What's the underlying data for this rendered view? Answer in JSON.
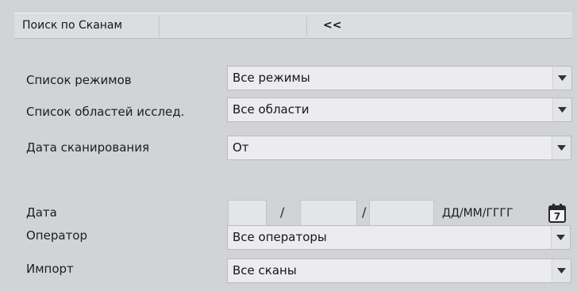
{
  "panel": {
    "title": "Поиск по Сканам",
    "collapse_label": "<<"
  },
  "rows": {
    "modes": {
      "label": "Список режимов",
      "value": "Все режимы"
    },
    "regions": {
      "label": "Список областей исслед.",
      "value": "Все области"
    },
    "scan_date": {
      "label": "Дата сканирования",
      "value": "От"
    },
    "date": {
      "label": "Дата",
      "separator_1": "/",
      "separator_2": "/",
      "format_hint": "ДД/ММ/ГГГГ",
      "day_value": "",
      "month_value": "",
      "year_value": ""
    },
    "operator": {
      "label": "Оператор",
      "value": "Все операторы"
    },
    "import": {
      "label": "Импорт",
      "value": "Все сканы"
    }
  },
  "icons": {
    "dropdown": "chevron-down-icon",
    "calendar": "calendar-icon",
    "calendar_day": "7"
  }
}
